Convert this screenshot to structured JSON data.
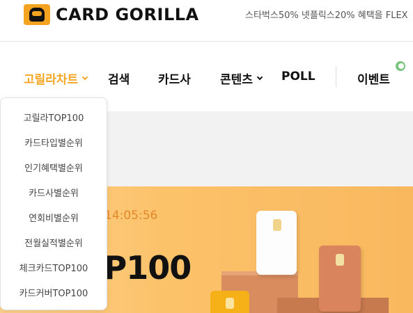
{
  "header": {
    "logo_text": "CARD GORILLA",
    "promo_text": "스타벅스50% 넷플릭스20% 혜택을 FLEX"
  },
  "nav": {
    "items": [
      {
        "label": "고릴라차트",
        "active": true,
        "has_dropdown": true
      },
      {
        "label": "검색",
        "active": false,
        "has_dropdown": false
      },
      {
        "label": "카드사",
        "active": false,
        "has_dropdown": false
      },
      {
        "label": "콘텐츠",
        "active": false,
        "has_dropdown": true
      },
      {
        "label": "POLL",
        "active": false,
        "has_dropdown": false
      },
      {
        "label": "이벤트",
        "active": false,
        "has_dropdown": false
      }
    ]
  },
  "dropdown": {
    "items": [
      "고릴라TOP100",
      "카드타입별순위",
      "인기혜택별순위",
      "카드사별순위",
      "연회비별순위",
      "전월실적별순위",
      "체크카드TOP100",
      "카드커버TOP100"
    ]
  },
  "hero": {
    "timer": "14:05:56",
    "title": "TOP100"
  },
  "colors": {
    "accent": "#f5a623",
    "banner": "#fcc26a"
  }
}
